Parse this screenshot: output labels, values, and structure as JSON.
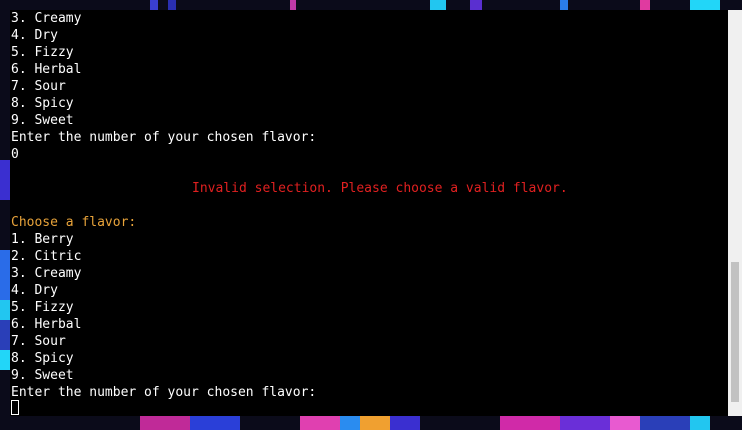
{
  "terminal": {
    "lines_before": [
      "3. Creamy",
      "4. Dry",
      "5. Fizzy",
      "6. Herbal",
      "7. Sour",
      "8. Spicy",
      "9. Sweet"
    ],
    "question_1": "Enter the number of your chosen flavor:",
    "user_input": "0",
    "error_message": "Invalid selection. Please choose a valid flavor.",
    "prompt_title": "Choose a flavor:",
    "options": [
      "1. Berry",
      "2. Citric",
      "3. Creamy",
      "4. Dry",
      "5. Fizzy",
      "6. Herbal",
      "7. Sour",
      "8. Spicy",
      "9. Sweet"
    ],
    "question_2": "Enter the number of your chosen flavor:"
  },
  "colors": {
    "text": "#ffffff",
    "prompt": "#e8a33a",
    "error": "#e02020",
    "background": "#000000"
  }
}
